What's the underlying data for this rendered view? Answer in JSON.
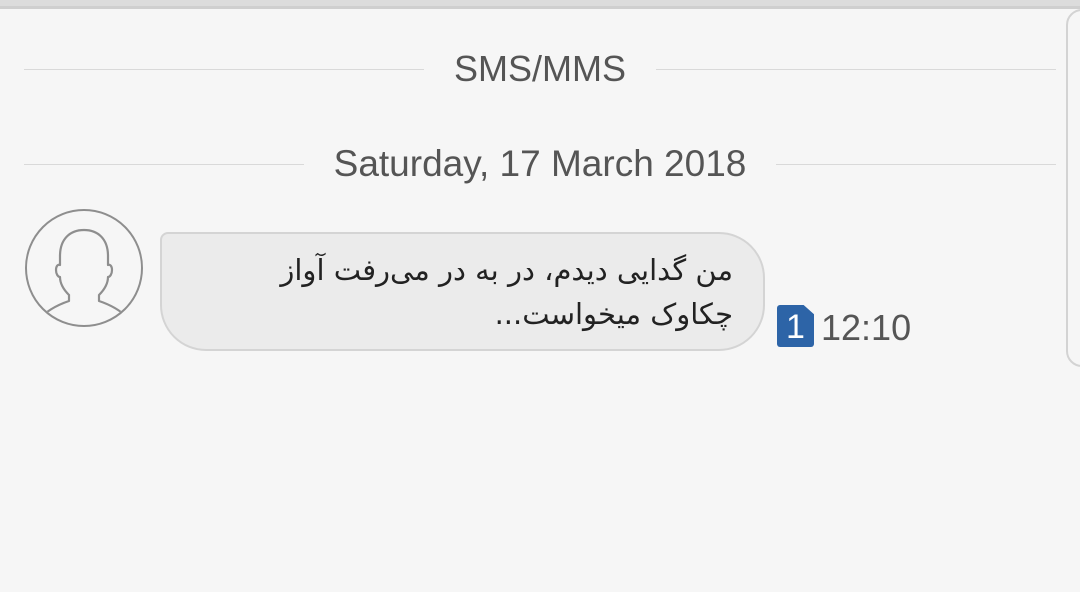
{
  "thread": {
    "channel_label": "SMS/MMS",
    "date_label": "Saturday, 17 March 2018"
  },
  "message": {
    "avatar_icon": "person-placeholder-icon",
    "lines": [
      "من گدایی دیدم، در به در می‌رفت آواز",
      "چکاوک میخواست..."
    ],
    "sim_slot": "1",
    "time": "12:10"
  },
  "colors": {
    "background": "#f6f6f6",
    "bubble": "#ebebeb",
    "sim_badge": "#2d64a7",
    "secondary_text": "#555555"
  }
}
